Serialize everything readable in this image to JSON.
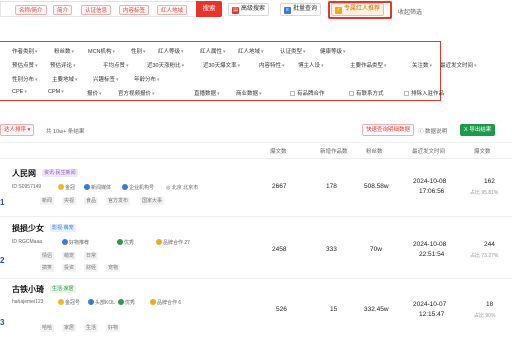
{
  "search": {
    "chips": [
      "名称/简介",
      "简介",
      "认证信息",
      "内容标签",
      "红人地域"
    ],
    "button": "搜索",
    "advanced": "高级搜索",
    "batch": "批量查询",
    "pro": "专属红人推荐",
    "recent": "收起筛选"
  },
  "filters": {
    "row1": [
      "作者类别",
      "粉丝数",
      "MCN机构",
      "性别",
      "红人等级",
      "红人属性",
      "红人地域",
      "认证类型",
      "健康等级"
    ],
    "row2": [
      "预估点赞",
      "预估评论",
      "平均点赞",
      "近30天涨粉比",
      "近30天爆文率",
      "内容特性",
      "博主人设",
      "主要作品类型",
      "关注数",
      "最近发文时间"
    ],
    "row3": [
      "性别分布",
      "主要地域",
      "兴趣标签",
      "年龄分布"
    ],
    "row4": [
      "CPE",
      "CPM",
      "报价",
      "官方视频报价",
      "直播数据",
      "商业数据",
      "商业数据"
    ],
    "checks": [
      "有品牌合作",
      "有联系方式",
      "排除入驻作品"
    ]
  },
  "toolbar": {
    "left": "达人排序",
    "result": "共 10w+ 条结果",
    "r1": "快速查询明细数据",
    "r2": "数据说明",
    "r3": "导出结果"
  },
  "table": {
    "headers": [
      "爆文数",
      "新增作品数",
      "粉丝数",
      "最近发文时间",
      "爆文数"
    ],
    "rows": [
      {
        "rank": "1",
        "name": "人民网",
        "category": "资讯·民生新闻",
        "id": "S0957149",
        "badges": [
          "金冠",
          "新闻媒体",
          "企业机构号",
          "北京 北京市"
        ],
        "tags": [
          "新闻",
          "央视",
          "食品",
          "官方发布",
          "国家大事"
        ],
        "views": "2667",
        "new_posts": "178",
        "fans": "508.58w",
        "date": "2024-10-08",
        "time": "17:06:56",
        "hits": "162",
        "hits_sub": "占比 95.81%"
      },
      {
        "rank": "2",
        "name": "损损少女",
        "category": "影视·萌宠",
        "id": "RGCMaaa",
        "badges": [
          "好物推荐",
          "优秀",
          "品牌合作 27"
        ],
        "tags": [
          "情侣",
          "萌宠",
          "日常",
          "搞笑",
          "投资",
          "财经",
          "宠物"
        ],
        "views": "2458",
        "new_posts": "333",
        "fans": "70w",
        "date": "2024-10-08",
        "time": "22:51:54",
        "hits": "244",
        "hits_sub": "占比 73.27%"
      },
      {
        "rank": "3",
        "name": "古铁小琦",
        "category": "生活·家居",
        "id": "hahajemei123",
        "badges": [
          "金冠号",
          "头部KOL",
          "优秀",
          "品牌合作 6"
        ],
        "tags": [
          "哈哈",
          "家居",
          "生活",
          "好物"
        ],
        "views": "526",
        "new_posts": "15",
        "fans": "332.45w",
        "date": "2024-10-07",
        "time": "12:15:47",
        "hits": "18",
        "hits_sub": "占比 90%"
      }
    ]
  }
}
